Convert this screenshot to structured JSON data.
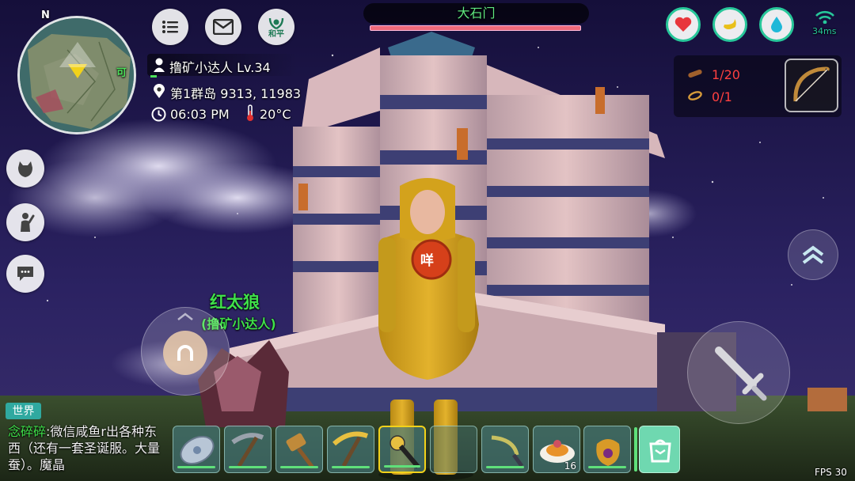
{
  "compass": {
    "north": "N",
    "map_label": "可"
  },
  "top_buttons": {
    "peace_label": "和平"
  },
  "target": {
    "name": "大石门"
  },
  "player": {
    "name": "撸矿小达人",
    "level": "Lv.34",
    "location": "第1群岛 9313, 11983",
    "time": "06:03 PM",
    "temperature": "20°C"
  },
  "network": {
    "ping": "34ms"
  },
  "quest": {
    "items": [
      {
        "progress": "1/20"
      },
      {
        "progress": "0/1"
      }
    ]
  },
  "npc": {
    "name": "红太狼",
    "subtitle": "(撸矿小达人)"
  },
  "character": {
    "badge": "咩"
  },
  "chat": {
    "channel": "世界",
    "sender": "念碎碎",
    "message": ":微信咸鱼r出各种东西（还有一套圣诞服。大量蚕）。魔晶"
  },
  "hotbar": {
    "slots": [
      {
        "icon": "shield-disc-icon"
      },
      {
        "icon": "pickaxe-icon"
      },
      {
        "icon": "hammer-icon"
      },
      {
        "icon": "golden-pickaxe-icon"
      },
      {
        "icon": "mace-icon",
        "selected": true
      },
      {
        "icon": "empty-slot"
      },
      {
        "icon": "sickle-icon"
      },
      {
        "icon": "food-plate-icon",
        "count": "16"
      },
      {
        "icon": "pouch-icon"
      },
      {
        "icon": "bag-icon"
      }
    ]
  },
  "fps": "FPS 30",
  "colors": {
    "accent": "#27c79a",
    "npc_name": "#3fe04a",
    "target_name": "#5fe880",
    "quest_text": "#ff4040",
    "chat_sender": "#3fe04a",
    "chat_channel": "#2fa9a0"
  }
}
